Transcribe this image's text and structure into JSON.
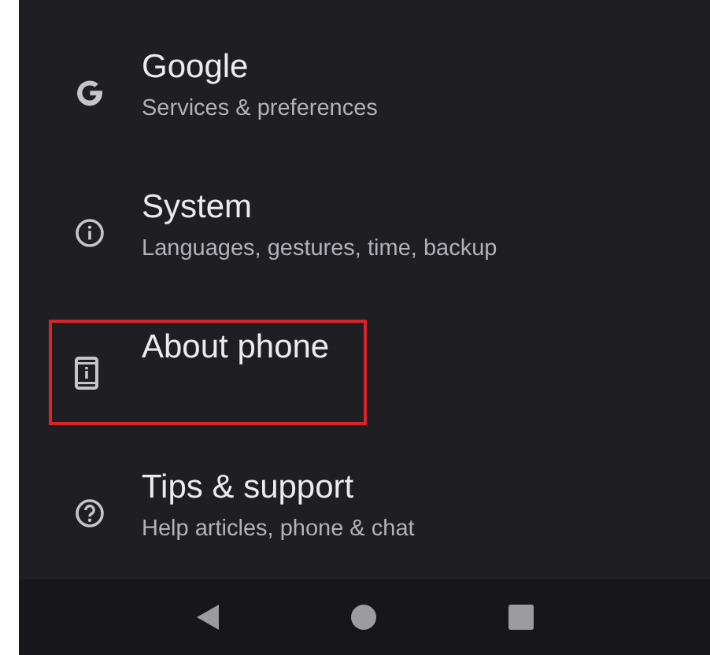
{
  "settings_items": [
    {
      "kind": "google",
      "title": "Google",
      "subtitle": "Services & preferences",
      "highlighted": false
    },
    {
      "kind": "info",
      "title": "System",
      "subtitle": "Languages, gestures, time, backup",
      "highlighted": false
    },
    {
      "kind": "phone",
      "title": "About phone",
      "highlighted": true
    },
    {
      "kind": "help",
      "title": "Tips & support",
      "subtitle": "Help articles, phone & chat",
      "highlighted": false
    }
  ],
  "nav_bar": {
    "buttons": [
      {
        "kind": "back"
      },
      {
        "kind": "home"
      },
      {
        "kind": "recents"
      }
    ]
  }
}
